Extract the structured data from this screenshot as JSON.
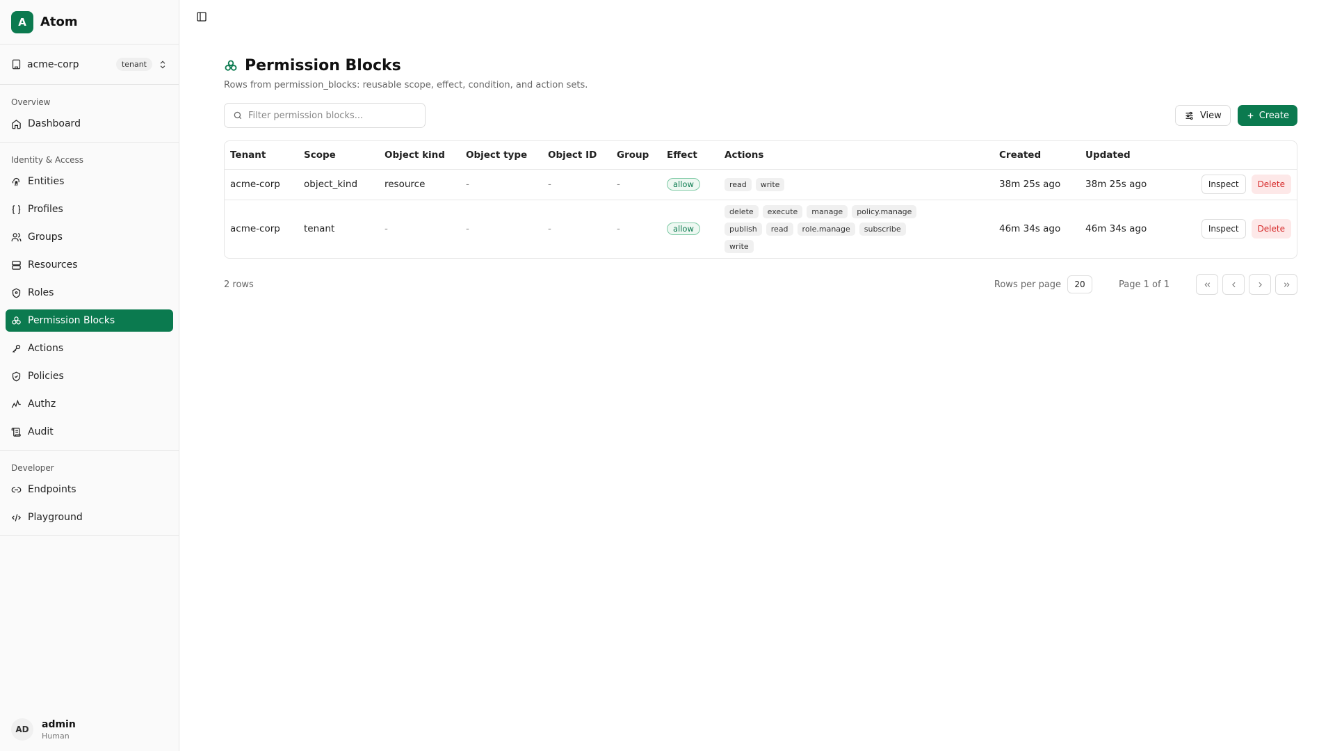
{
  "brand": {
    "logo_letter": "A",
    "name": "Atom",
    "accent": "#0b7a4f"
  },
  "tenant": {
    "name": "acme-corp",
    "badge": "tenant"
  },
  "nav": {
    "overview": {
      "heading": "Overview",
      "items": [
        {
          "label": "Dashboard",
          "icon": "home-icon"
        }
      ]
    },
    "identity": {
      "heading": "Identity & Access",
      "items": [
        {
          "label": "Entities",
          "icon": "fingerprint-icon"
        },
        {
          "label": "Profiles",
          "icon": "braces-icon"
        },
        {
          "label": "Groups",
          "icon": "users-icon"
        },
        {
          "label": "Resources",
          "icon": "database-icon"
        },
        {
          "label": "Roles",
          "icon": "shield-icon"
        },
        {
          "label": "Permission Blocks",
          "icon": "blocks-icon",
          "active": true
        },
        {
          "label": "Actions",
          "icon": "key-icon"
        },
        {
          "label": "Policies",
          "icon": "shield-check-icon"
        },
        {
          "label": "Authz",
          "icon": "activity-icon"
        },
        {
          "label": "Audit",
          "icon": "scroll-icon"
        }
      ]
    },
    "developer": {
      "heading": "Developer",
      "items": [
        {
          "label": "Endpoints",
          "icon": "link-icon"
        },
        {
          "label": "Playground",
          "icon": "code-icon"
        }
      ]
    }
  },
  "user": {
    "initials": "AD",
    "name": "admin",
    "role": "Human"
  },
  "page": {
    "title": "Permission Blocks",
    "description": "Rows from permission_blocks: reusable scope, effect, condition, and action sets."
  },
  "toolbar": {
    "search_placeholder": "Filter permission blocks...",
    "view_label": "View",
    "create_label": "Create"
  },
  "table": {
    "columns": [
      "Tenant",
      "Scope",
      "Object kind",
      "Object type",
      "Object ID",
      "Group",
      "Effect",
      "Actions",
      "Created",
      "Updated"
    ],
    "rows": [
      {
        "tenant": "acme-corp",
        "scope": "object_kind",
        "object_kind": "resource",
        "object_type": "-",
        "object_id": "-",
        "group": "-",
        "effect": "allow",
        "actions": [
          "read",
          "write"
        ],
        "created": "38m 25s ago",
        "updated": "38m 25s ago"
      },
      {
        "tenant": "acme-corp",
        "scope": "tenant",
        "object_kind": "-",
        "object_type": "-",
        "object_id": "-",
        "group": "-",
        "effect": "allow",
        "actions": [
          "delete",
          "execute",
          "manage",
          "policy.manage",
          "publish",
          "read",
          "role.manage",
          "subscribe",
          "write"
        ],
        "created": "46m 34s ago",
        "updated": "46m 34s ago"
      }
    ],
    "inspect_label": "Inspect",
    "delete_label": "Delete"
  },
  "footer": {
    "row_count": "2 rows",
    "rows_per_page_label": "Rows per page",
    "rows_per_page_value": "20",
    "page_info": "Page 1 of 1"
  }
}
